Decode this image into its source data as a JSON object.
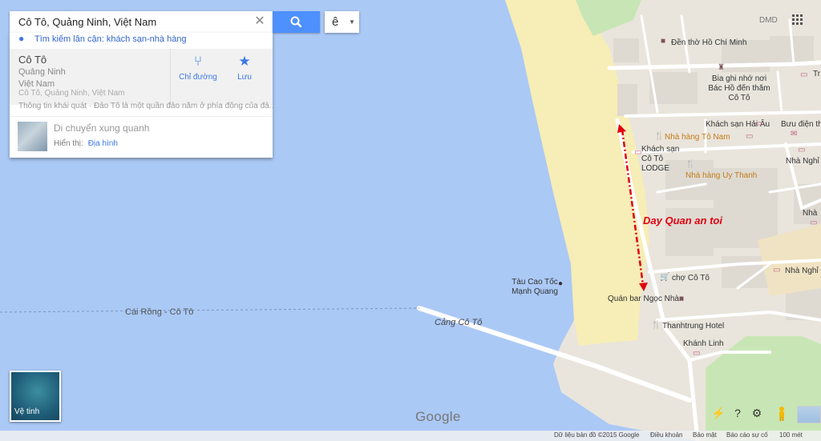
{
  "search": {
    "value": "Cô Tô, Quảng Ninh, Việt Nam",
    "clear_icon": "close-icon",
    "search_icon": "search-icon"
  },
  "language_button": {
    "label": "ê"
  },
  "nearby": {
    "label": "Tìm kiếm lân cận: khách sạn-nhà hàng"
  },
  "place": {
    "name": "Cô Tô",
    "line1": "Quảng Ninh",
    "line2": "Việt Nam",
    "line3": "Cô Tô, Quảng Ninh, Việt Nam",
    "directions_label": "Chỉ đường",
    "save_label": "Lưu",
    "overview": "Thông tin khái quát · Đảo Tô là một quần đảo nằm ở phía đông của đả..."
  },
  "explore": {
    "title": "Di chuyển xung quanh",
    "show_label": "Hiển thị:",
    "show_link": "Địa hình"
  },
  "satellite": {
    "label": "Vệ tinh"
  },
  "top_right": {
    "label": "DMD"
  },
  "map_labels": {
    "route": "Cái Rồng - Cô Tô",
    "port": "Cảng Cô Tô",
    "boat": "Tàu Cao Tốc Mạnh Quang",
    "ho_chi_minh_temple": "Đền thờ Hồ Chí Minh",
    "memorial": "Bia ghi nhớ nơi Bác Hồ đến thăm Cô Tô",
    "hai_au": "Khách sạn Hải Âu",
    "post_office": "Bưu điện thị",
    "to_nam": "Nhà hàng Tô Nam",
    "lodge": "Khách sạn Cô Tô LODGE",
    "uy_thanh": "Nhà hàng Uy Thanh",
    "nha_nghi_1": "Nhà Nghỉ M",
    "nha_nghi_2": "Nhà Nghỉ Đ",
    "nha": "Nhà",
    "tr": "Tr",
    "market": "chợ Cô Tô",
    "quan_bar": "Quán bar Ngọc Nhàn",
    "thanhtrung": "Thanhtrung Hotel",
    "khanh_linh": "Khánh Linh"
  },
  "annotation": {
    "text": "Day Quan an toi",
    "color": "#e00010"
  },
  "google_logo": "Google",
  "footer": {
    "copyright": "Dữ liệu bản đồ ©2015 Google",
    "terms": "Điều khoản",
    "privacy": "Bảo mật",
    "report": "Báo cáo sự cố",
    "scale": "100 mét"
  },
  "colors": {
    "water": "#abc9f5",
    "land": "#e9e5dc",
    "beach": "#f7edb6",
    "park": "#c8e6b5",
    "accent": "#4d90fe"
  }
}
